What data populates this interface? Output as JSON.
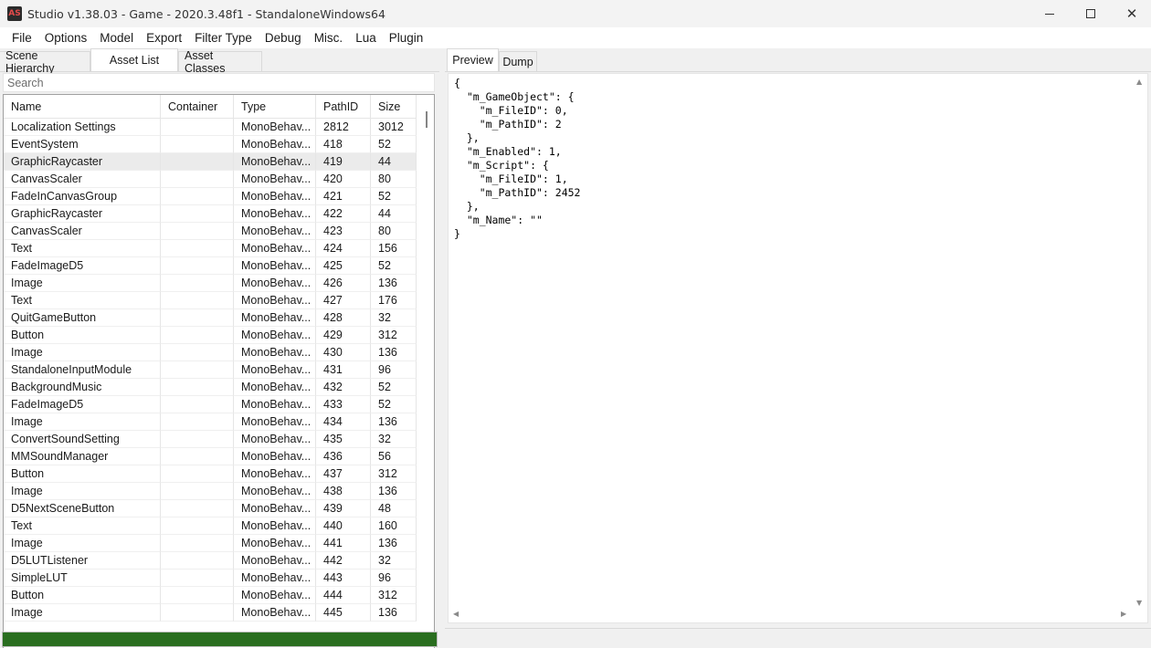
{
  "window": {
    "title": "Studio v1.38.03 - Game - 2020.3.48f1 - StandaloneWindows64",
    "icon_name": "app-logo-icon",
    "icon_text": "AS",
    "minimize_icon": "minimize-icon",
    "maximize_icon": "maximize-icon",
    "close_icon": "close-icon",
    "close_glyph": "✕"
  },
  "menu": [
    "File",
    "Options",
    "Model",
    "Export",
    "Filter Type",
    "Debug",
    "Misc.",
    "Lua",
    "Plugin"
  ],
  "left_tabs": [
    "Scene Hierarchy",
    "Asset List",
    "Asset Classes"
  ],
  "left_active_tab": "Asset List",
  "search": {
    "placeholder": "Search",
    "value": ""
  },
  "columns": [
    "Name",
    "Container",
    "Type",
    "PathID",
    "Size"
  ],
  "rows": [
    {
      "name": "Localization Settings",
      "container": "",
      "type": "MonoBehav...",
      "pathid": "2812",
      "size": "3012"
    },
    {
      "name": "EventSystem",
      "container": "",
      "type": "MonoBehav...",
      "pathid": "418",
      "size": "52"
    },
    {
      "name": "GraphicRaycaster",
      "container": "",
      "type": "MonoBehav...",
      "pathid": "419",
      "size": "44"
    },
    {
      "name": "CanvasScaler",
      "container": "",
      "type": "MonoBehav...",
      "pathid": "420",
      "size": "80"
    },
    {
      "name": "FadeInCanvasGroup",
      "container": "",
      "type": "MonoBehav...",
      "pathid": "421",
      "size": "52"
    },
    {
      "name": "GraphicRaycaster",
      "container": "",
      "type": "MonoBehav...",
      "pathid": "422",
      "size": "44"
    },
    {
      "name": "CanvasScaler",
      "container": "",
      "type": "MonoBehav...",
      "pathid": "423",
      "size": "80"
    },
    {
      "name": "Text",
      "container": "",
      "type": "MonoBehav...",
      "pathid": "424",
      "size": "156"
    },
    {
      "name": "FadeImageD5",
      "container": "",
      "type": "MonoBehav...",
      "pathid": "425",
      "size": "52"
    },
    {
      "name": "Image",
      "container": "",
      "type": "MonoBehav...",
      "pathid": "426",
      "size": "136"
    },
    {
      "name": "Text",
      "container": "",
      "type": "MonoBehav...",
      "pathid": "427",
      "size": "176"
    },
    {
      "name": "QuitGameButton",
      "container": "",
      "type": "MonoBehav...",
      "pathid": "428",
      "size": "32"
    },
    {
      "name": "Button",
      "container": "",
      "type": "MonoBehav...",
      "pathid": "429",
      "size": "312"
    },
    {
      "name": "Image",
      "container": "",
      "type": "MonoBehav...",
      "pathid": "430",
      "size": "136"
    },
    {
      "name": "StandaloneInputModule",
      "container": "",
      "type": "MonoBehav...",
      "pathid": "431",
      "size": "96"
    },
    {
      "name": "BackgroundMusic",
      "container": "",
      "type": "MonoBehav...",
      "pathid": "432",
      "size": "52"
    },
    {
      "name": "FadeImageD5",
      "container": "",
      "type": "MonoBehav...",
      "pathid": "433",
      "size": "52"
    },
    {
      "name": "Image",
      "container": "",
      "type": "MonoBehav...",
      "pathid": "434",
      "size": "136"
    },
    {
      "name": "ConvertSoundSetting",
      "container": "",
      "type": "MonoBehav...",
      "pathid": "435",
      "size": "32"
    },
    {
      "name": "MMSoundManager",
      "container": "",
      "type": "MonoBehav...",
      "pathid": "436",
      "size": "56"
    },
    {
      "name": "Button",
      "container": "",
      "type": "MonoBehav...",
      "pathid": "437",
      "size": "312"
    },
    {
      "name": "Image",
      "container": "",
      "type": "MonoBehav...",
      "pathid": "438",
      "size": "136"
    },
    {
      "name": "D5NextSceneButton",
      "container": "",
      "type": "MonoBehav...",
      "pathid": "439",
      "size": "48"
    },
    {
      "name": "Text",
      "container": "",
      "type": "MonoBehav...",
      "pathid": "440",
      "size": "160"
    },
    {
      "name": "Image",
      "container": "",
      "type": "MonoBehav...",
      "pathid": "441",
      "size": "136"
    },
    {
      "name": "D5LUTListener",
      "container": "",
      "type": "MonoBehav...",
      "pathid": "442",
      "size": "32"
    },
    {
      "name": "SimpleLUT",
      "container": "",
      "type": "MonoBehav...",
      "pathid": "443",
      "size": "96"
    },
    {
      "name": "Button",
      "container": "",
      "type": "MonoBehav...",
      "pathid": "444",
      "size": "312"
    },
    {
      "name": "Image",
      "container": "",
      "type": "MonoBehav...",
      "pathid": "445",
      "size": "136"
    }
  ],
  "selected_row_index": 2,
  "right_tabs": [
    "Preview",
    "Dump"
  ],
  "right_active_tab": "Preview",
  "preview_text": "{\n  \"m_GameObject\": {\n    \"m_FileID\": 0,\n    \"m_PathID\": 2\n  },\n  \"m_Enabled\": 1,\n  \"m_Script\": {\n    \"m_FileID\": 1,\n    \"m_PathID\": 2452\n  },\n  \"m_Name\": \"\"\n}",
  "progress": {
    "fraction": 1.0,
    "color": "#2a6e20"
  },
  "colors": {
    "selection": "#ebebeb",
    "progress": "#2a6e20"
  }
}
